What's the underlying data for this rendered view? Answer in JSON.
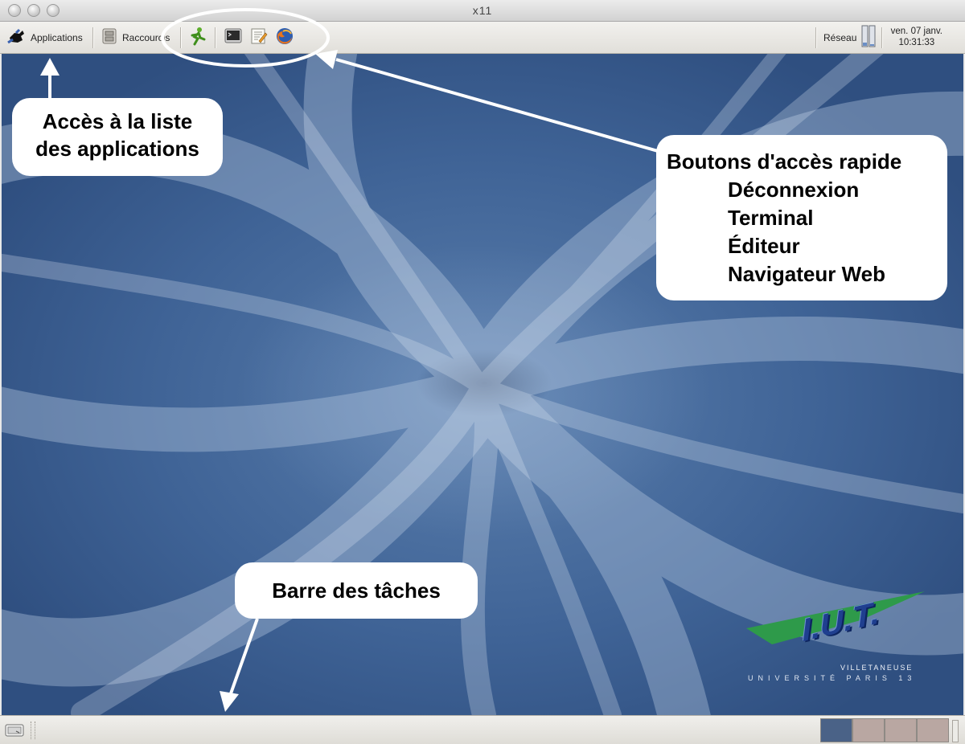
{
  "window": {
    "title": "x11"
  },
  "top_panel": {
    "applications_label": "Applications",
    "raccourcis_label": "Raccourcis",
    "quick_launch": [
      {
        "icon": "logout-runner-icon"
      },
      {
        "icon": "terminal-icon"
      },
      {
        "icon": "text-editor-icon"
      },
      {
        "icon": "firefox-icon"
      }
    ],
    "network_label": "Réseau",
    "clock": {
      "date": "ven. 07 janv.",
      "time": "10:31:33"
    }
  },
  "annotations": {
    "apps_list": {
      "line1": "Accès à la liste",
      "line2": "des applications"
    },
    "quick_buttons": {
      "heading": "Boutons d'accès rapide",
      "items": [
        "Déconnexion",
        "Terminal",
        "Éditeur",
        "Navigateur Web"
      ]
    },
    "taskbar": "Barre des tâches"
  },
  "logo": {
    "text": "I.U.T.",
    "subtitle1": "VILLETANEUSE",
    "subtitle2": "UNIVERSITÉ PARIS 13"
  },
  "colors": {
    "desktop_blue": "#3f6396",
    "active_workspace": "#4a6287",
    "inactive_workspace": "#b9a7a2",
    "logo_green": "#2e9a4a",
    "logo_blue": "#1f3f8f"
  }
}
